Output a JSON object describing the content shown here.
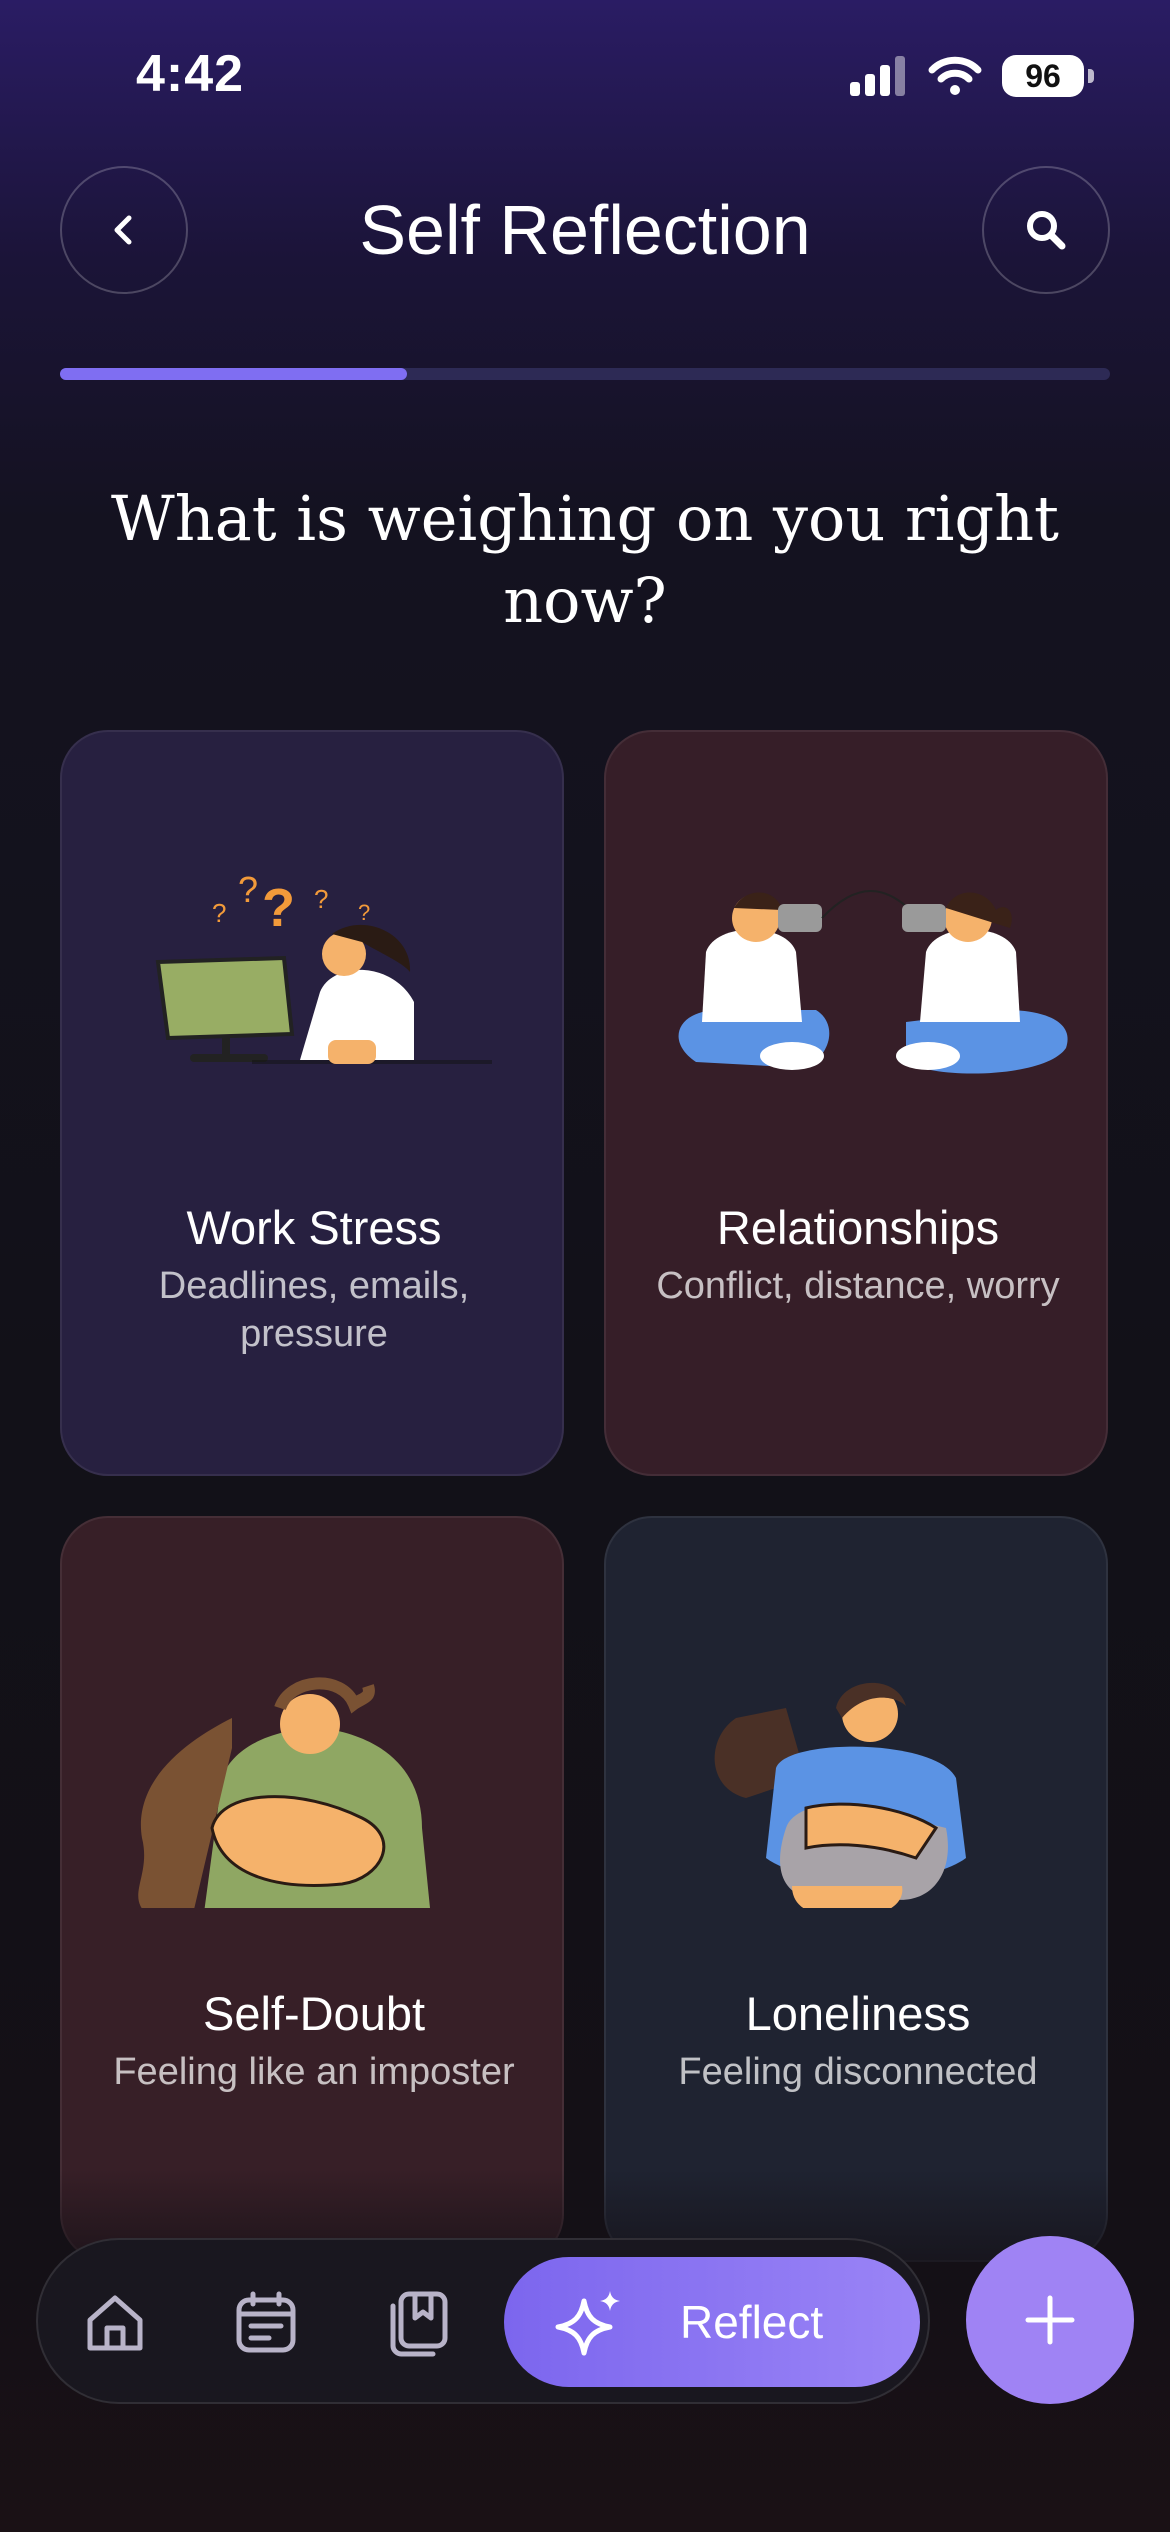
{
  "status_bar": {
    "time": "4:42",
    "battery": "96"
  },
  "header": {
    "title": "Self Reflection"
  },
  "progress": {
    "value": 0.33
  },
  "question": "What is weighing on you right now?",
  "cards": [
    {
      "title": "Work Stress",
      "description": "Deadlines, emails, pressure"
    },
    {
      "title": "Relationships",
      "description": "Conflict, distance, worry"
    },
    {
      "title": "Self-Doubt",
      "description": "Feeling like an imposter"
    },
    {
      "title": "Loneliness",
      "description": "Feeling disconnected"
    }
  ],
  "bottom_nav": {
    "items": [
      "home-icon",
      "calendar-icon",
      "journal-icon"
    ],
    "reflect_label": "Reflect",
    "colors": {
      "accent": "#8b74f3",
      "fab": "#9f83f4"
    }
  }
}
